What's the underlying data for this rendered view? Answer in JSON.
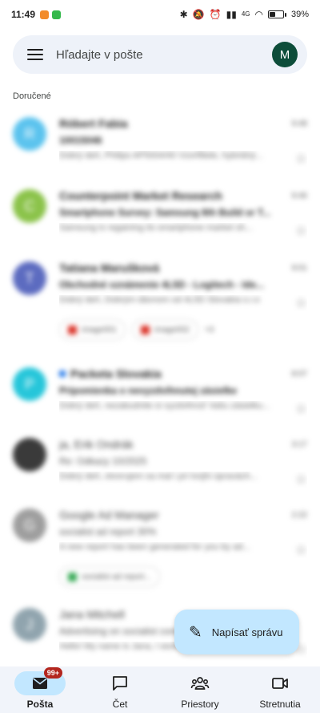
{
  "status_bar": {
    "time": "11:49",
    "battery_text": "39%",
    "battery_level": 0.39,
    "signal_label": "4G"
  },
  "search": {
    "placeholder": "Hľadajte v pošte",
    "avatar_letter": "M",
    "avatar_color": "#0d4d3a"
  },
  "section_label": "Doručené",
  "mail": [
    {
      "avatar": "R",
      "avatar_color": "#5bc3ee",
      "sender": "Róbert Fabia",
      "time": "9:48",
      "subject": "10015046",
      "snippet": "Dobrý deň, Philips AP5004/40 Vzorfiltele, hybridný...",
      "unread": true
    },
    {
      "avatar": "C",
      "avatar_color": "#8bc34a",
      "sender": "Counterpoint Market Research",
      "time": "9:46",
      "subject": "Smartphone Survey: Samsung 8th Build or T...",
      "snippet": "Samsung is regaining its smartphone market sh...",
      "unread": true
    },
    {
      "avatar": "T",
      "avatar_color": "#5c6bc0",
      "sender": "Tatiana Marušková",
      "time": "9:01",
      "subject": "Obchodné oznámenie 4L5D - Logitech - Ide...",
      "snippet": "Dobrý deň, Dobrým dávnom od 4L5D Slovakia s.r.o",
      "unread": true,
      "attachments": [
        "image001",
        "image002"
      ],
      "more_attachments": "+3"
    },
    {
      "avatar": "P",
      "avatar_color": "#26c6da",
      "sender": "Packeta Slovakia",
      "time": "8:07",
      "subject": "Pripomienka o nevyzdvihnutej zásielke",
      "snippet": "Dobrý deň, nezabudnite si vyzdvihnúť Vašu zásielku...",
      "unread": true,
      "tagged": true
    },
    {
      "avatar": "",
      "avatar_color": "#3a3a3a",
      "sender": "ja, Erik Ondrák",
      "time": "3:17",
      "subject": "Re: Odkazy 10/2025",
      "snippet": "Dobrý deň, otvorujem sa mal i pri tvojhi úpravách...",
      "unread": false
    },
    {
      "avatar": "G",
      "avatar_color": "#9e9e9e",
      "sender": "Google Ad Manager",
      "time": "2:22",
      "subject": "socialist ad report 30%",
      "snippet": "A new report has been generated for you by ad...",
      "unread": false,
      "attachments": [
        "socialist ad report..."
      ]
    },
    {
      "avatar": "J",
      "avatar_color": "#90a4ae",
      "sender": "Jana Mitchell",
      "time": "",
      "subject": "Advertising on socialist company...",
      "snippet": "Hello! My name is Jana, I work at...",
      "unread": false
    }
  ],
  "fab": {
    "label": "Napísať správu",
    "icon": "pencil-icon"
  },
  "nav": [
    {
      "label": "Pošta",
      "icon": "mail-icon",
      "badge": "99+",
      "active": true
    },
    {
      "label": "Čet",
      "icon": "chat-icon",
      "active": false
    },
    {
      "label": "Priestory",
      "icon": "spaces-icon",
      "active": false
    },
    {
      "label": "Stretnutia",
      "icon": "video-icon",
      "active": false
    }
  ]
}
